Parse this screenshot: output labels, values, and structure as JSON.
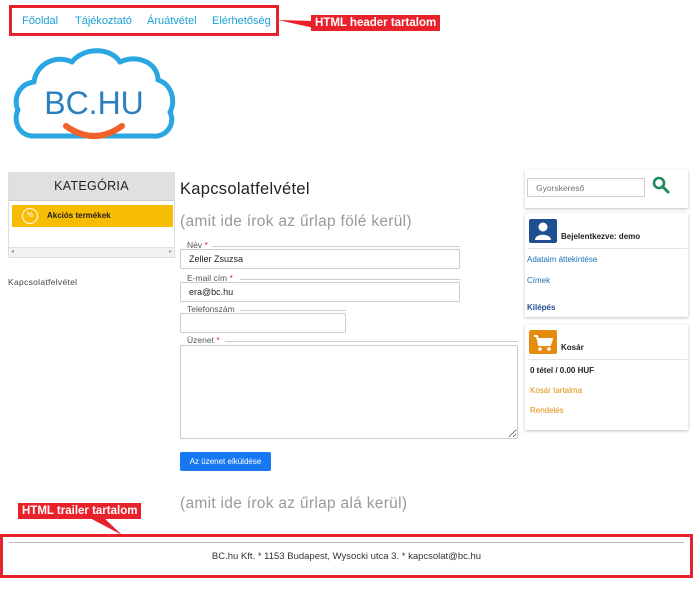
{
  "header": {
    "nav": [
      "Főoldal",
      "Tájékoztató",
      "Áruátvétel",
      "Elérhetőség"
    ],
    "callout": "HTML header tartalom"
  },
  "logo": {
    "text": "BC.HU"
  },
  "sidebar_left": {
    "category_title": "KATEGÓRIA",
    "promo_icon": "%",
    "promo_label": "Akciós termékek",
    "contact_link": "Kapcsolatfelvétel"
  },
  "main": {
    "title": "Kapcsolatfelvétel",
    "note_above": "(amit ide írok az űrlap fölé kerül)",
    "note_below": "(amit ide írok az űrlap alá kerül)",
    "form": {
      "name_label": "Név",
      "name_value": "Zeller Zsuzsa",
      "email_label": "E-mail cím",
      "email_value": "era@bc.hu",
      "phone_label": "Telefonszám",
      "phone_value": "",
      "message_label": "Üzenet",
      "message_value": "",
      "required_mark": "*",
      "submit_label": "Az üzenet elküldése"
    }
  },
  "sidebar_right": {
    "search_placeholder": "Gyorskereső",
    "logged_in": "Bejelentkezve: demo",
    "account_links": [
      "Adataim áttekintése",
      "Címek"
    ],
    "logout": "Kilépés",
    "cart_title": "Kosár",
    "cart_summary": "0 tétel / 0.00 HUF",
    "cart_links": [
      "Kosár tartalma",
      "Rendelés"
    ]
  },
  "footer": {
    "text": "BC.hu Kft. * 1153 Budapest, Wysocki utca 3. * kapcsolat@bc.hu",
    "callout": "HTML trailer tartalom"
  },
  "colors": {
    "accent_red": "#e8212a",
    "link_blue": "#1a9fd6",
    "promo_yellow": "#f7bc04",
    "button_blue": "#1877f2",
    "user_tile": "#1f4e91",
    "cart_tile": "#e58b10",
    "search_icon": "#1e8a5a",
    "logo_blue": "#2aa6e0",
    "logo_orange": "#f0622a"
  },
  "icons": {
    "search": "search-icon",
    "user": "user-icon",
    "cart": "shopping-cart-icon",
    "promo": "percent-icon"
  }
}
